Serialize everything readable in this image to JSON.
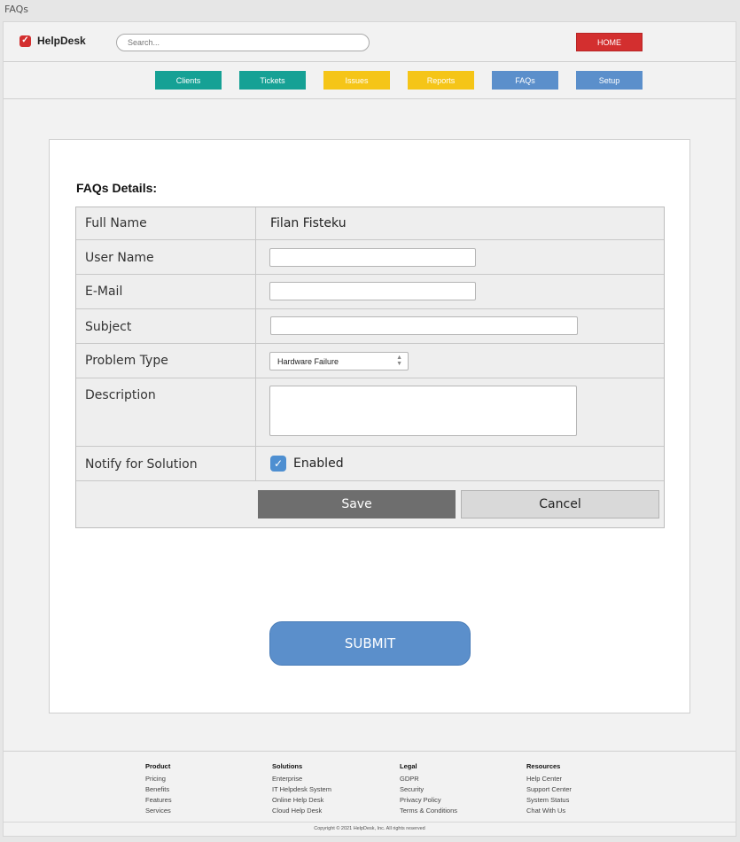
{
  "window": {
    "title": "FAQs"
  },
  "header": {
    "logo_text": "HelpDesk",
    "logo_icon": "check-square-icon",
    "search_placeholder": "Search...",
    "home_label": "HOME",
    "home_color": "#d32f2f"
  },
  "nav": {
    "items": [
      {
        "label": "Clients",
        "color": "#16a195"
      },
      {
        "label": "Tickets",
        "color": "#16a195"
      },
      {
        "label": "Issues",
        "color": "#f5c518"
      },
      {
        "label": "Reports",
        "color": "#f5c518"
      },
      {
        "label": "FAQs",
        "color": "#5b8fcb"
      },
      {
        "label": "Setup",
        "color": "#5b8fcb"
      }
    ]
  },
  "form": {
    "title": "FAQs Details:",
    "rows": {
      "full_name": {
        "label": "Full Name",
        "value": "Filan Fisteku"
      },
      "user_name": {
        "label": "User Name",
        "value": ""
      },
      "email": {
        "label": "E-Mail",
        "value": ""
      },
      "subject": {
        "label": "Subject",
        "value": ""
      },
      "problem_type": {
        "label": "Problem Type",
        "value": "Hardware Failure"
      },
      "description": {
        "label": "Description",
        "value": ""
      },
      "notify": {
        "label": "Notify for Solution",
        "checkbox_label": "Enabled",
        "checked": true
      }
    },
    "save_label": "Save",
    "cancel_label": "Cancel",
    "submit_label": "SUBMIT"
  },
  "footer": {
    "columns": [
      {
        "heading": "Product",
        "links": [
          "Pricing",
          "Benefits",
          "Features",
          "Services"
        ]
      },
      {
        "heading": "Solutions",
        "links": [
          "Enterprise",
          "IT Helpdesk System",
          "Online Help Desk",
          "Cloud Help Desk"
        ]
      },
      {
        "heading": "Legal",
        "links": [
          "GDPR",
          "Security",
          "Privacy Policy",
          "Terms & Conditions"
        ]
      },
      {
        "heading": "Resources",
        "links": [
          "Help Center",
          "Support Center",
          "System Status",
          "Chat With Us"
        ]
      }
    ],
    "copyright": "Copyright © 2021 HelpDesk, Inc. All rights reserved"
  }
}
